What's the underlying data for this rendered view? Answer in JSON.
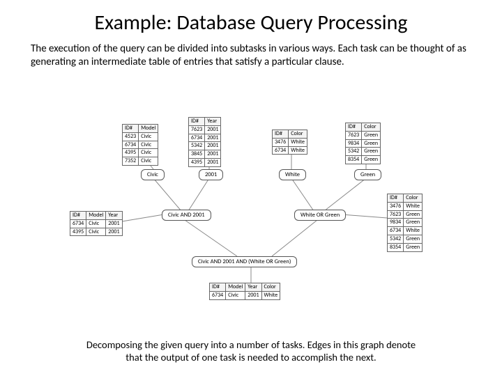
{
  "title": "Example: Database Query Processing",
  "intro": "The execution of the query can be divided into subtasks in various ways. Each task can be thought of as generating an intermediate table of entries that satisfy a particular clause.",
  "caption": "Decomposing the given query into a number of tasks. Edges in this graph denote that the output of one task is needed to accomplish the next.",
  "tables": {
    "t_model": {
      "headers": [
        "ID#",
        "Model"
      ],
      "rows": [
        [
          "4523",
          "Civic"
        ],
        [
          "6734",
          "Civic"
        ],
        [
          "4395",
          "Civic"
        ],
        [
          "7352",
          "Civic"
        ]
      ]
    },
    "t_year": {
      "headers": [
        "ID#",
        "Year"
      ],
      "rows": [
        [
          "7623",
          "2001"
        ],
        [
          "6734",
          "2001"
        ],
        [
          "5342",
          "2001"
        ],
        [
          "3845",
          "2001"
        ],
        [
          "4395",
          "2001"
        ]
      ]
    },
    "t_color_white": {
      "headers": [
        "ID#",
        "Color"
      ],
      "rows": [
        [
          "3476",
          "White"
        ],
        [
          "6734",
          "White"
        ]
      ]
    },
    "t_color_green": {
      "headers": [
        "ID#",
        "Color"
      ],
      "rows": [
        [
          "7623",
          "Green"
        ],
        [
          "9834",
          "Green"
        ],
        [
          "5342",
          "Green"
        ],
        [
          "8354",
          "Green"
        ]
      ]
    },
    "t_model_year": {
      "headers": [
        "ID#",
        "Model",
        "Year"
      ],
      "rows": [
        [
          "6734",
          "Civic",
          "2001"
        ],
        [
          "4395",
          "Civic",
          "2001"
        ]
      ]
    },
    "t_color_or": {
      "headers": [
        "ID#",
        "Color"
      ],
      "rows": [
        [
          "3476",
          "White"
        ],
        [
          "7623",
          "Green"
        ],
        [
          "9834",
          "Green"
        ],
        [
          "6734",
          "White"
        ],
        [
          "5342",
          "Green"
        ],
        [
          "8354",
          "Green"
        ]
      ]
    },
    "t_final": {
      "headers": [
        "ID#",
        "Model",
        "Year",
        "Color"
      ],
      "rows": [
        [
          "6734",
          "Civic",
          "2001",
          "White"
        ]
      ]
    }
  },
  "nodes": {
    "civic": "Civic",
    "y2001": "2001",
    "white": "White",
    "green": "Green",
    "civic_and_2001": "Civic AND 2001",
    "white_or_green": "White OR Green",
    "final": "Civic AND 2001 AND (White OR Green)"
  }
}
